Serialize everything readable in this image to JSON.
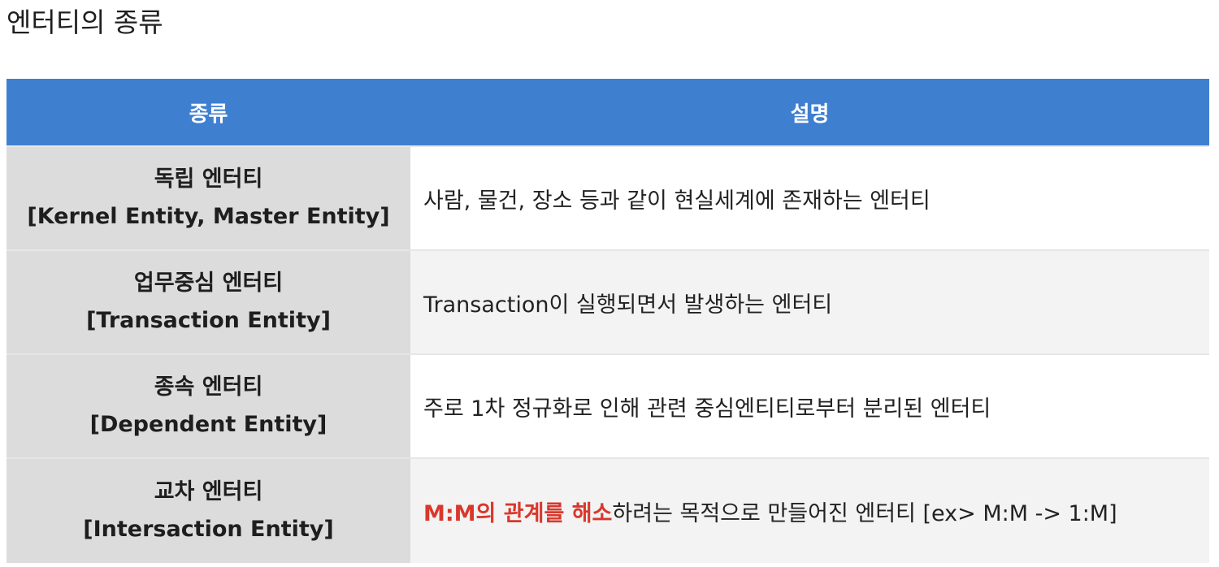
{
  "page": {
    "title": "엔터티의 종류"
  },
  "table": {
    "headers": {
      "kind": "종류",
      "description": "설명"
    },
    "rows": [
      {
        "kind_ko": "독립 엔터티",
        "kind_en": "[Kernel Entity, Master Entity]",
        "description": "사람, 물건, 장소 등과 같이 현실세계에 존재하는 엔터티"
      },
      {
        "kind_ko": "업무중심 엔터티",
        "kind_en": "[Transaction Entity]",
        "description": "Transaction이 실행되면서 발생하는 엔터티"
      },
      {
        "kind_ko": "종속 엔터티",
        "kind_en": "[Dependent Entity]",
        "description": "주로 1차 정규화로 인해 관련 중심엔티티로부터 분리된 엔터티"
      },
      {
        "kind_ko": "교차 엔터티",
        "kind_en": "[Intersaction Entity]",
        "description_emphasis": "M:M의 관계를 해소",
        "description_rest": "하려는 목적으로 만들어진 엔터티 [ex> M:M -> 1:M]"
      }
    ]
  },
  "colors": {
    "header_bg": "#3f7fd0",
    "header_text": "#ffffff",
    "kind_cell_bg": "#dcdcdc",
    "alt_row_bg": "#f3f3f3",
    "emphasis_text": "#d8382c"
  }
}
